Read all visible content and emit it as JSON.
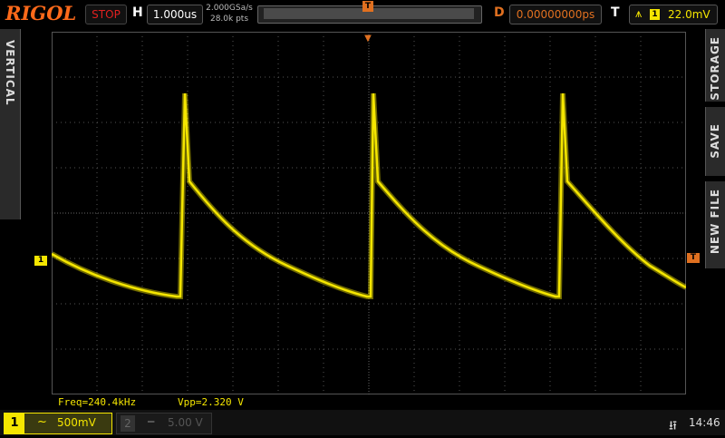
{
  "brand": "RIGOL",
  "header": {
    "run_status": "STOP",
    "h_label": "H",
    "timebase": "1.000us",
    "sample_rate": "2.000GSa/s",
    "mem_depth": "28.0k pts",
    "trigger_marker": "T",
    "d_label": "D",
    "delay": "0.00000000ps",
    "t_label": "T",
    "trigger_channel": "1",
    "trigger_level": "22.0mV"
  },
  "side_tabs": {
    "left": "VERTICAL",
    "right": [
      "STORAGE",
      "SAVE",
      "NEW FILE"
    ]
  },
  "markers": {
    "ch1_ground": "1",
    "trigger_top": "T",
    "trigger_level": "T"
  },
  "measurements": {
    "freq": "Freq=240.4kHz",
    "vpp": "Vpp=2.320 V"
  },
  "channels": [
    {
      "number": "1",
      "coupling": "~",
      "scale": "500mV",
      "active": true,
      "color": "#f5e600"
    },
    {
      "number": "2",
      "coupling": "",
      "scale": "5.00 V",
      "active": false,
      "color": "#555555"
    }
  ],
  "footer": {
    "usb_icon": "usb-icon",
    "time": "14:46"
  },
  "colors": {
    "trace": "#f5e600",
    "trigger": "#e07020",
    "brand": "#ff6a1a",
    "stop": "#e02020"
  }
}
